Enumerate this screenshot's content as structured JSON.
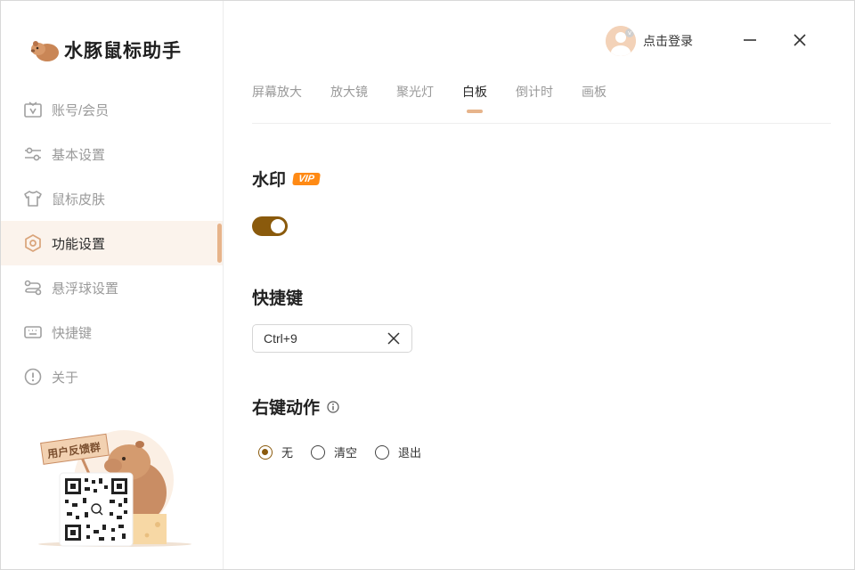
{
  "app": {
    "name": "水豚鼠标助手"
  },
  "header": {
    "login_label": "点击登录"
  },
  "sidebar": {
    "items": [
      {
        "label": "账号/会员",
        "icon": "vip-account-icon",
        "active": false
      },
      {
        "label": "基本设置",
        "icon": "sliders-icon",
        "active": false
      },
      {
        "label": "鼠标皮肤",
        "icon": "tshirt-icon",
        "active": false
      },
      {
        "label": "功能设置",
        "icon": "hexagon-settings-icon",
        "active": true
      },
      {
        "label": "悬浮球设置",
        "icon": "float-ball-icon",
        "active": false
      },
      {
        "label": "快捷键",
        "icon": "keyboard-icon",
        "active": false
      },
      {
        "label": "关于",
        "icon": "info-circle-icon",
        "active": false
      }
    ],
    "promo": {
      "sign_text": "用户反馈群"
    }
  },
  "tabs": [
    {
      "label": "屏幕放大",
      "active": false
    },
    {
      "label": "放大镜",
      "active": false
    },
    {
      "label": "聚光灯",
      "active": false
    },
    {
      "label": "白板",
      "active": true
    },
    {
      "label": "倒计时",
      "active": false
    },
    {
      "label": "画板",
      "active": false
    }
  ],
  "watermark": {
    "title": "水印",
    "badge": "VIP",
    "enabled": true
  },
  "hotkey": {
    "title": "快捷键",
    "value": "Ctrl+9"
  },
  "right_click": {
    "title": "右键动作",
    "options": [
      {
        "label": "无",
        "checked": true
      },
      {
        "label": "清空",
        "checked": false
      },
      {
        "label": "退出",
        "checked": false
      }
    ]
  },
  "colors": {
    "accent": "#e7b48b",
    "toggle_on": "#8a5a0c",
    "vip": "#ff8a14",
    "active_bg": "#fbf3ec"
  }
}
